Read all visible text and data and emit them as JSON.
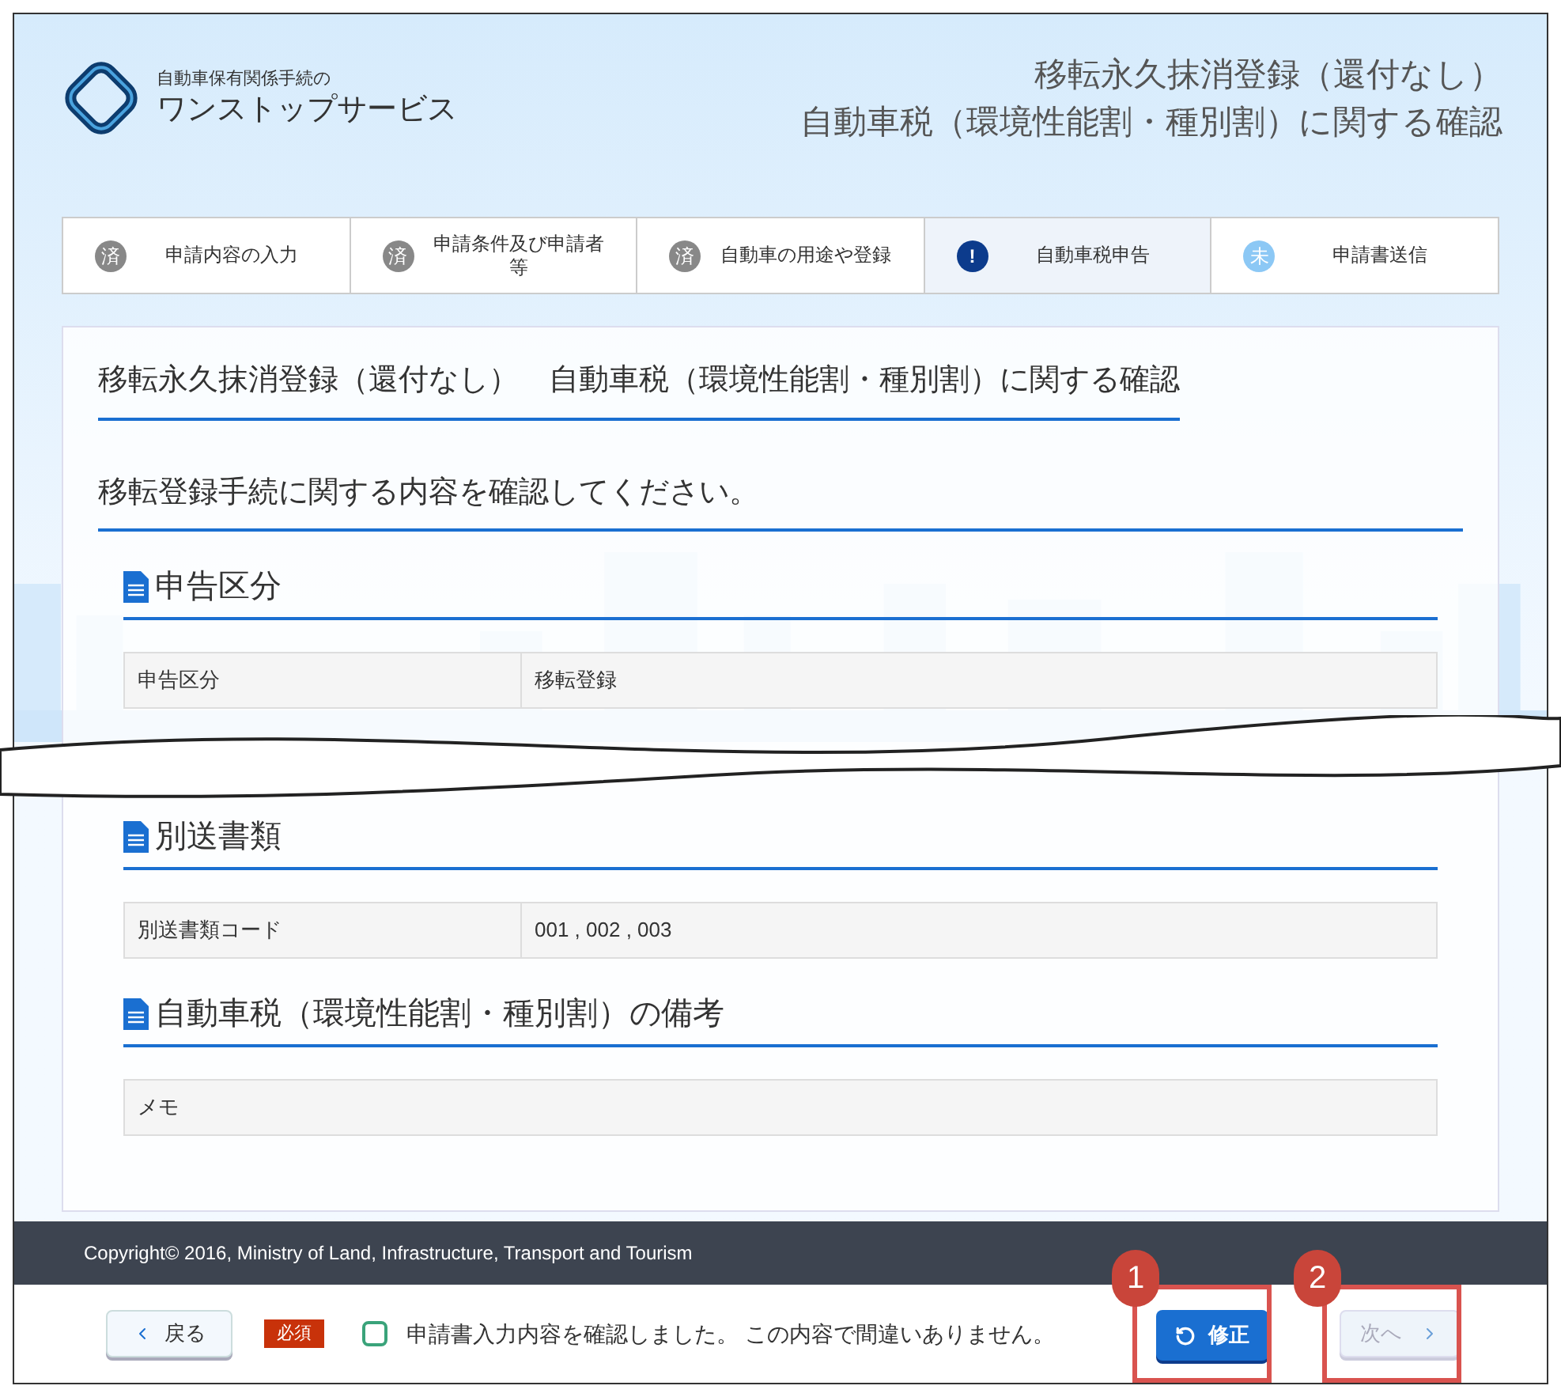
{
  "header": {
    "logo_caption": "自動車保有関係手続の",
    "logo_title": "ワンストップサービス",
    "title_lines": [
      "移転永久抹消登録（還付なし）",
      "自動車税（環境性能割・種別割）に関する確認"
    ]
  },
  "steps": [
    {
      "badge": "済",
      "label": "申請内容の入力",
      "kind": "done",
      "selected": false
    },
    {
      "badge": "済",
      "label": "申請条件及び申請者等",
      "kind": "done",
      "selected": false
    },
    {
      "badge": "済",
      "label": "自動車の用途や登録",
      "kind": "done",
      "selected": false
    },
    {
      "badge": "!",
      "label": "自動車税申告",
      "kind": "current",
      "selected": true
    },
    {
      "badge": "未",
      "label": "申請書送信",
      "kind": "todo",
      "selected": false
    }
  ],
  "page_title": "移転永久抹消登録（還付なし）　自動車税（環境性能割・種別割）に関する確認",
  "instruction": "移転登録手続に関する内容を確認してください。",
  "sections": [
    {
      "title": "申告区分",
      "rows": [
        {
          "label": "申告区分",
          "value": "移転登録"
        }
      ]
    },
    {
      "title": "別送書類",
      "rows": [
        {
          "label": "別送書類コード",
          "value": "001 , 002 , 003"
        }
      ]
    },
    {
      "title": "自動車税（環境性能割・種別割）の備考",
      "rows": [
        {
          "label": "メモ"
        }
      ]
    }
  ],
  "footer": {
    "copyright": "Copyright© 2016, Ministry of Land, Infrastructure, Transport and Tourism"
  },
  "bottom_bar": {
    "back": "戻る",
    "required": "必須",
    "confirm": {
      "label": "申請書入力内容を確認しました。 この内容で間違いありません。",
      "checked": false
    },
    "edit": "修正",
    "next": {
      "label": "次へ",
      "disabled": true
    }
  },
  "callouts": [
    "1",
    "2"
  ]
}
